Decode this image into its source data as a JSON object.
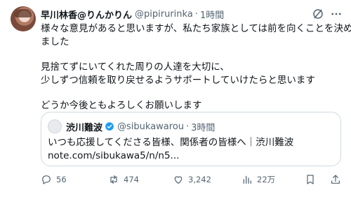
{
  "author": {
    "display_name": "早川林香@りんかりん",
    "handle": "@pipirurinka",
    "time": "1時間"
  },
  "body_lines": [
    "様々な意見があると思いますが、私たち家族としては前を向くことを決め",
    "ました",
    "見捨てずにいてくれた周りの人達を大切に、",
    "少しずつ信頼を取り戻せるようサポートしていけたらと思います",
    "どうか今後ともよろしくお願いします"
  ],
  "quoted": {
    "display_name": "渋川難波",
    "handle": "@sibukawarou",
    "time": "3時間",
    "text_line1": "いつも応援してくださる皆様、関係者の皆様へ｜渋川難波",
    "text_line2": "note.com/sibukawa5/n/n5..."
  },
  "actions": {
    "replies": "56",
    "reposts": "474",
    "likes": "3,242",
    "views": "22万"
  },
  "separator": "·",
  "colors": {
    "accent": "#1d9bf0",
    "muted": "#536471",
    "text": "#0f1419",
    "border": "#cfd9de"
  },
  "icons": [
    "grok-icon",
    "more-icon",
    "verified-icon",
    "reply-icon",
    "repost-icon",
    "like-icon",
    "views-icon",
    "bookmark-icon",
    "share-icon"
  ]
}
